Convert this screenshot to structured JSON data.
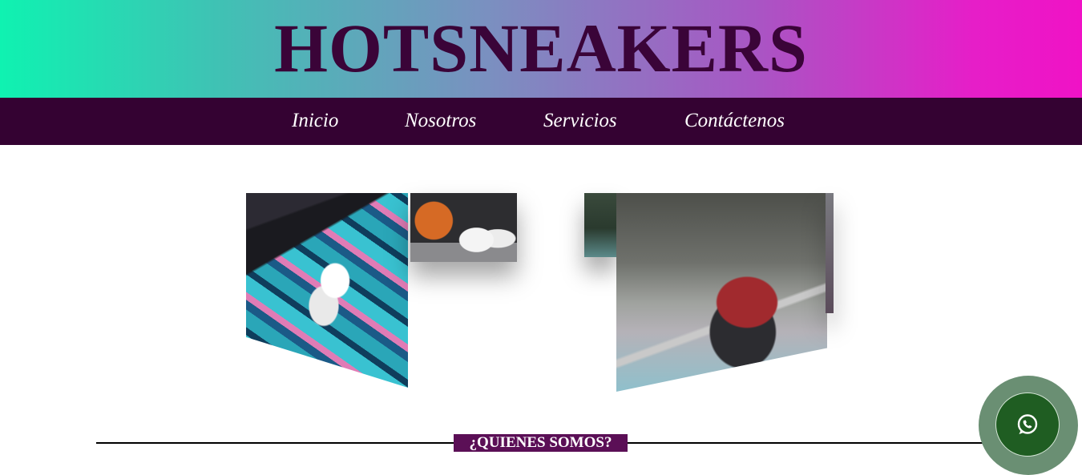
{
  "header": {
    "brand": "HOTSNEAKERS"
  },
  "nav": {
    "items": [
      {
        "label": "Inicio"
      },
      {
        "label": "Nosotros"
      },
      {
        "label": "Servicios"
      },
      {
        "label": "Contáctenos"
      }
    ]
  },
  "gallery": {
    "left": {
      "images": [
        "sneakers-on-graffiti",
        "sneakers-with-basketball"
      ]
    },
    "right": {
      "images": [
        "red-nike-sneaker-thumb",
        "red-nike-sneaker-on-skateboard"
      ]
    }
  },
  "section": {
    "title": "¿QUIENES SOMOS?"
  },
  "whatsapp": {
    "icon": "whatsapp-icon",
    "outer_color": "#6a8f73",
    "inner_color": "#1f5d22"
  },
  "colors": {
    "gradient_start": "#0ff2b1",
    "gradient_end": "#f012c6",
    "nav_bg": "#340232",
    "brand_text": "#3a0438",
    "section_badge": "#5b0f56"
  }
}
